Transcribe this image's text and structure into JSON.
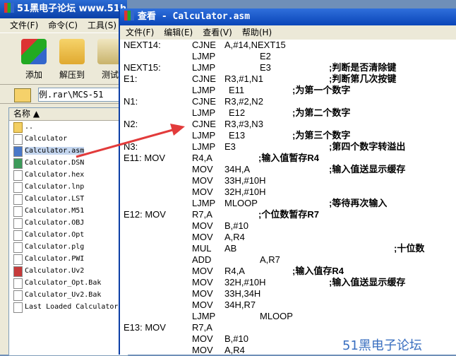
{
  "back_window": {
    "title": "51黑电子论坛 www.51h",
    "menu": [
      "文件(F)",
      "命令(C)",
      "工具(S)"
    ],
    "toolbar": [
      {
        "label": "添加",
        "icon": "add-archive-icon"
      },
      {
        "label": "解压到",
        "icon": "extract-folder-icon"
      },
      {
        "label": "测试",
        "icon": "test-clipboard-icon"
      }
    ],
    "address_path": "例.rar\\MCS-51",
    "list_header": "名称",
    "files": [
      {
        "name": "..",
        "icon": "folder-icon"
      },
      {
        "name": "Calculator",
        "icon": "file-icon"
      },
      {
        "name": "Calculator.asm",
        "icon": "asm-file-icon",
        "selected": true
      },
      {
        "name": "Calculator.DSN",
        "icon": "dsn-file-icon"
      },
      {
        "name": "Calculator.hex",
        "icon": "file-icon"
      },
      {
        "name": "Calculator.lnp",
        "icon": "file-icon"
      },
      {
        "name": "Calculator.LST",
        "icon": "file-icon"
      },
      {
        "name": "Calculator.M51",
        "icon": "file-icon"
      },
      {
        "name": "Calculator.OBJ",
        "icon": "file-icon"
      },
      {
        "name": "Calculator.Opt",
        "icon": "file-icon"
      },
      {
        "name": "Calculator.plg",
        "icon": "file-icon"
      },
      {
        "name": "Calculator.PWI",
        "icon": "file-icon"
      },
      {
        "name": "Calculator.Uv2",
        "icon": "uv2-file-icon"
      },
      {
        "name": "Calculator_Opt.Bak",
        "icon": "file-icon"
      },
      {
        "name": "Calculator_Uv2.Bak",
        "icon": "file-icon"
      },
      {
        "name": "Last Loaded Calculator",
        "icon": "file-icon"
      }
    ]
  },
  "editor": {
    "title": "查看 - Calculator.asm",
    "menu": [
      "文件(F)",
      "编辑(E)",
      "查看(V)",
      "帮助(H)"
    ],
    "lines": [
      {
        "label": "NEXT14:",
        "op": "CJNE",
        "args": "A,#14,NEXT15",
        "comment": ""
      },
      {
        "label": "",
        "op": "LJMP",
        "args": "E2",
        "comment": ""
      },
      {
        "label": "NEXT15:",
        "op": "LJMP",
        "args": "E3",
        "comment": ";判断是否清除键"
      },
      {
        "label": "E1:",
        "op": "CJNE",
        "args": "R3,#1,N1",
        "comment": ";判断第几次按键"
      },
      {
        "label": "",
        "op": "LJMP",
        "args": "E11",
        "comment": ";为第一个数字"
      },
      {
        "label": "N1:",
        "op": "CJNE",
        "args": "R3,#2,N2",
        "comment": ""
      },
      {
        "label": "",
        "op": "LJMP",
        "args": "E12",
        "comment": ";为第二个数字"
      },
      {
        "label": "N2:",
        "op": "CJNE",
        "args": "R3,#3,N3",
        "comment": ""
      },
      {
        "label": "",
        "op": "LJMP",
        "args": "E13",
        "comment": ";为第三个数字"
      },
      {
        "label": "N3:",
        "op": "LJMP",
        "args": "E3",
        "comment": ";第四个数字转溢出"
      },
      {
        "label": "E11:    MOV",
        "op": "R4,A",
        "args": "",
        "comment": ";输入值暂存R4"
      },
      {
        "label": "",
        "op": "MOV",
        "args": "34H,A",
        "comment": ";输入值送显示缓存"
      },
      {
        "label": "",
        "op": "MOV",
        "args": "33H,#10H",
        "comment": ""
      },
      {
        "label": "",
        "op": "MOV",
        "args": "32H,#10H",
        "comment": ""
      },
      {
        "label": "",
        "op": "LJMP",
        "args": "MLOOP",
        "comment": ";等待再次输入"
      },
      {
        "label": "E12:    MOV",
        "op": "R7,A",
        "args": "",
        "comment": ";个位数暂存R7"
      },
      {
        "label": "",
        "op": "MOV",
        "args": "B,#10",
        "comment": ""
      },
      {
        "label": "",
        "op": "MOV",
        "args": "A,R4",
        "comment": ""
      },
      {
        "label": "",
        "op": "MUL",
        "args": "AB",
        "comment": ";十位数"
      },
      {
        "label": "",
        "op": "ADD",
        "args": "A,R7",
        "comment": ""
      },
      {
        "label": "",
        "op": "MOV",
        "args": "R4,A",
        "comment": ";输入值存R4"
      },
      {
        "label": "",
        "op": "MOV",
        "args": "32H,#10H",
        "comment": ";输入值送显示缓存"
      },
      {
        "label": "",
        "op": "MOV",
        "args": "33H,34H",
        "comment": ""
      },
      {
        "label": "",
        "op": "MOV",
        "args": "34H,R7",
        "comment": ""
      },
      {
        "label": "",
        "op": "LJMP",
        "args": "MLOOP",
        "comment": ""
      },
      {
        "label": "E13:    MOV",
        "op": "R7,A",
        "args": "",
        "comment": ""
      },
      {
        "label": "",
        "op": "MOV",
        "args": "B,#10",
        "comment": ""
      },
      {
        "label": "",
        "op": "MOV",
        "args": "A,R4",
        "comment": ""
      }
    ],
    "watermark": "51黑电子论坛"
  },
  "colors": {
    "arrow": "#e23b3b",
    "title_blue": "#0a45b8",
    "watermark": "#3a6fc0"
  }
}
